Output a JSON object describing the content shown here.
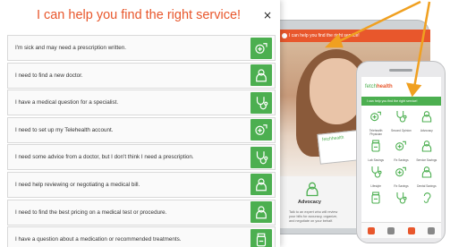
{
  "dialog": {
    "title": "I can help you find the right service!",
    "close": "×",
    "options": [
      {
        "label": "I'm sick and may need a prescription written.",
        "icon": "prescription-icon"
      },
      {
        "label": "I need to find a new doctor.",
        "icon": "doctor-icon"
      },
      {
        "label": "I have a medical question for a specialist.",
        "icon": "stethoscope-icon"
      },
      {
        "label": "I need to set up my Telehealth account.",
        "icon": "prescription-icon"
      },
      {
        "label": "I need some advice from a doctor, but I don't think I need a prescription.",
        "icon": "stethoscope-icon"
      },
      {
        "label": "I need help reviewing or negotiating a medical bill.",
        "icon": "doctor-icon"
      },
      {
        "label": "I need to find the best pricing on a medical test or procedure.",
        "icon": "doctor-icon"
      },
      {
        "label": "I have a question about a medication or recommended treatments.",
        "icon": "pill-bottle-icon"
      }
    ]
  },
  "tablet": {
    "bar_text": "I can help you find the right service!",
    "card_brand": "fetchhealth",
    "advocacy_title": "Advocacy",
    "advocacy_text": "Talk to an expert who will review your bills for accuracy, organize, and negotiate on your behalf."
  },
  "phone": {
    "brand_prefix": "fetch",
    "brand_suffix": "health",
    "bar_text": "I can help you find the right service!",
    "tiles": [
      {
        "label": "Telehealth Physician",
        "icon": "prescription-icon"
      },
      {
        "label": "Second Opinion",
        "icon": "stethoscope-icon"
      },
      {
        "label": "Advocacy",
        "icon": "doctor-icon"
      },
      {
        "label": "Lab Savings",
        "icon": "pill-bottle-icon"
      },
      {
        "label": "Rx Savings",
        "icon": "prescription-icon"
      },
      {
        "label": "Service Savings",
        "icon": "doctor-icon"
      },
      {
        "label": "Lifestyle",
        "icon": "stethoscope-icon"
      },
      {
        "label": "Rx Savings",
        "icon": "prescription-icon"
      },
      {
        "label": "Dental Savings",
        "icon": "doctor-icon"
      },
      {
        "label": "",
        "icon": "pill-bottle-icon"
      },
      {
        "label": "",
        "icon": "stethoscope-icon"
      },
      {
        "label": "",
        "icon": "hearing-icon"
      }
    ]
  },
  "colors": {
    "accent": "#e8572c",
    "green": "#4caf50"
  }
}
